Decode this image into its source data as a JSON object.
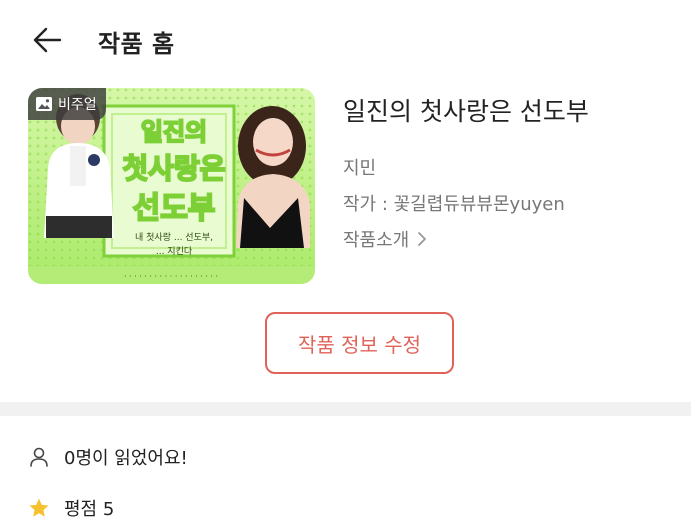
{
  "header": {
    "title": "작품 홈",
    "back_icon": "arrow-left-icon"
  },
  "work": {
    "badge_label": "비주얼",
    "badge_icon": "image-icon",
    "cover_texts": {
      "title_art": "일진의 첫사랑은 선도부",
      "tagline_1": "내 첫사랑 ... 선도부,",
      "tagline_2": "... 지킨다",
      "bottom_line": "..."
    },
    "title": "일진의 첫사랑은 선도부",
    "author": "지민",
    "writer": "작가 : 꽃길렵듀뷰뷰몬yuyen",
    "intro_label": "작품소개",
    "intro_chevron": "chevron-right-icon"
  },
  "actions": {
    "edit_label": "작품 정보 수정"
  },
  "stats": {
    "readers_text": "0명이 읽었어요!",
    "readers_icon": "person-icon",
    "rating_text": "평점 5",
    "rating_icon": "star-icon"
  },
  "colors": {
    "accent": "#e0635a",
    "star": "#f6c12e",
    "cover_green": "#b8f07a",
    "divider": "#f1f1f1"
  }
}
